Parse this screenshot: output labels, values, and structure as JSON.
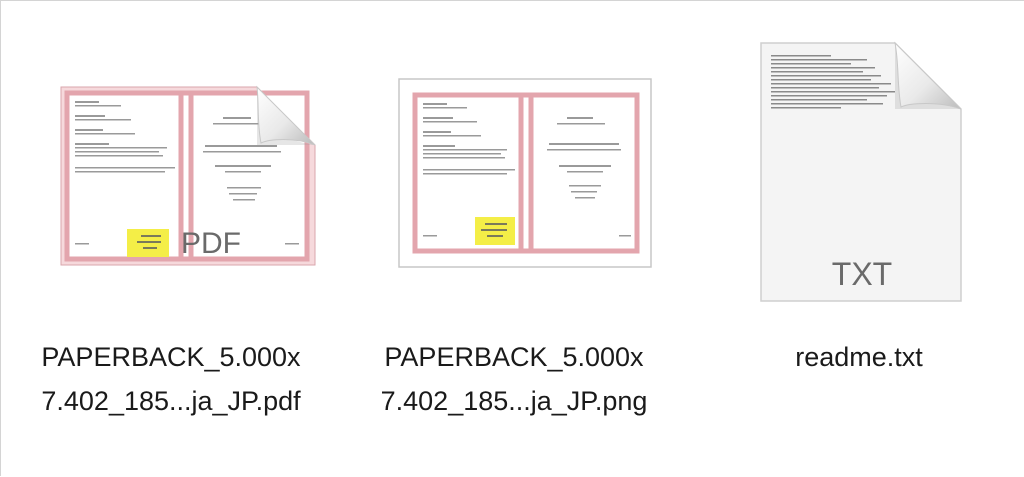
{
  "window": {
    "view": "icon-view"
  },
  "files": [
    {
      "name_line1": "PAPERBACK_5.000x",
      "name_line2": "7.402_185...ja_JP.pdf",
      "icon": "pdf-document-icon",
      "badge": "PDF"
    },
    {
      "name_line1": "PAPERBACK_5.000x",
      "name_line2": "7.402_185...ja_JP.png",
      "icon": "png-image-thumbnail-icon",
      "badge": ""
    },
    {
      "name_line1": "readme.txt",
      "name_line2": "",
      "icon": "text-document-icon",
      "badge": "TXT"
    }
  ],
  "colors": {
    "trim_line": "#e0a0a8",
    "highlight": "#f4ee47",
    "badge_text": "#6a6a6a"
  }
}
